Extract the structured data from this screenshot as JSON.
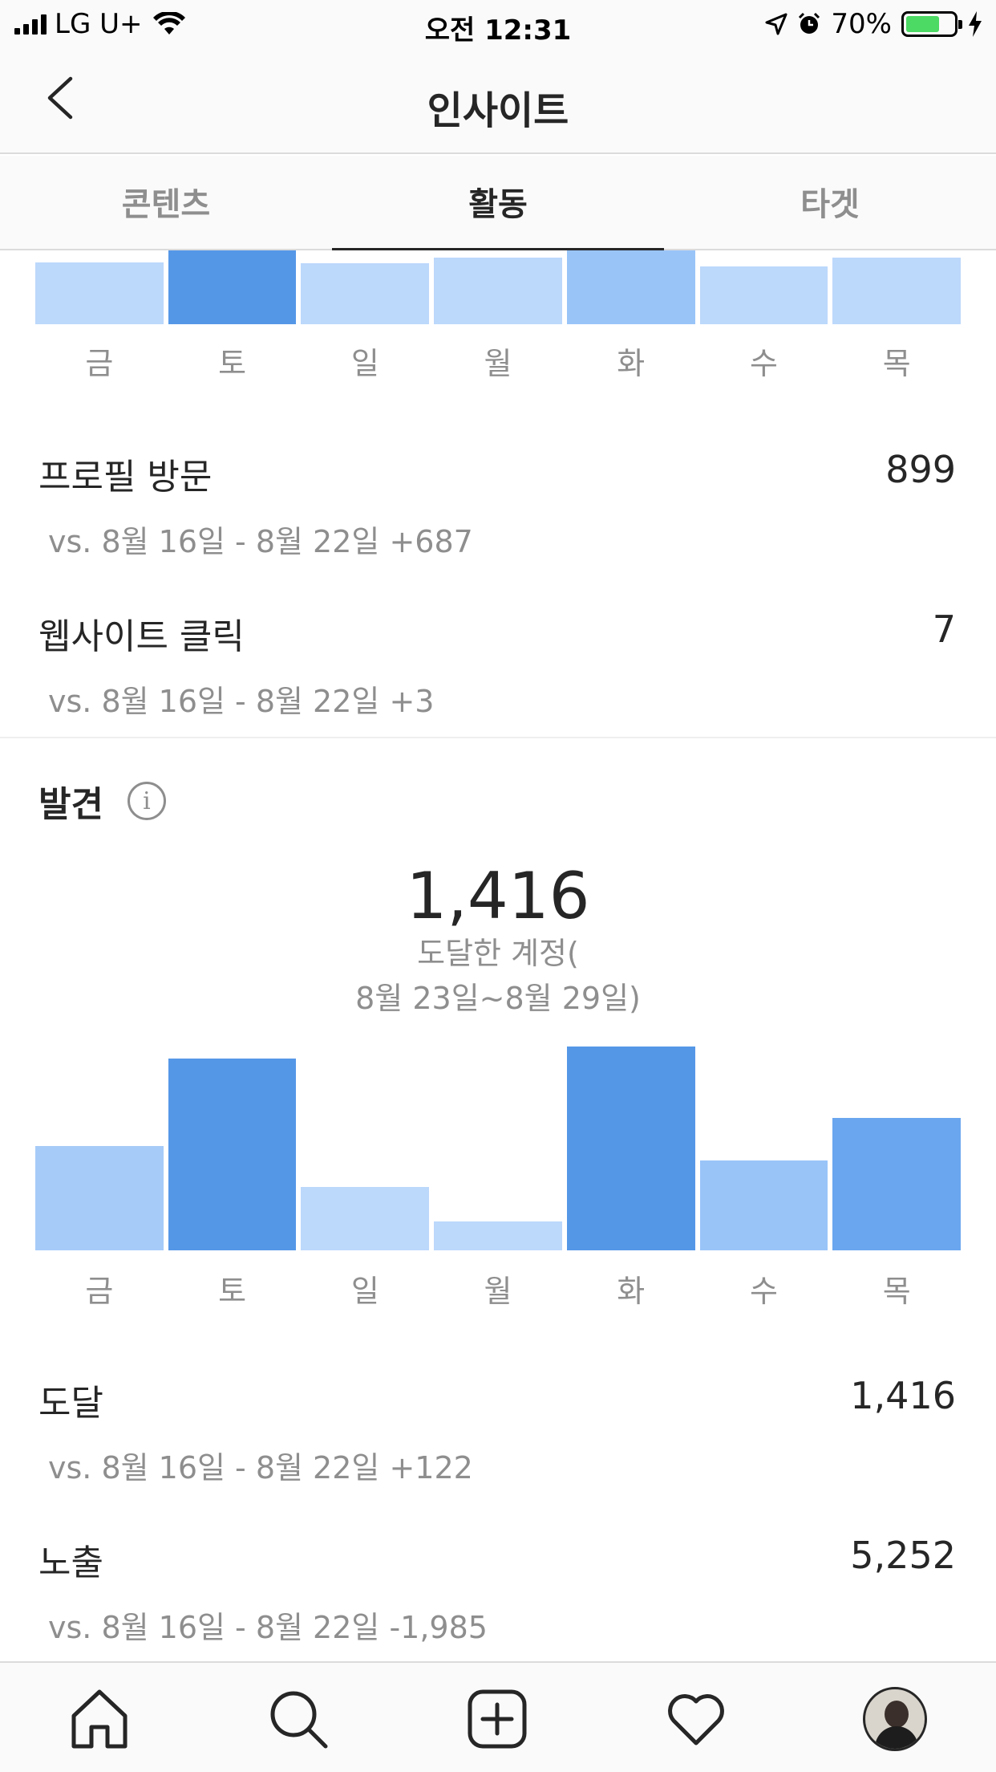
{
  "status_bar": {
    "carrier": "LG U+",
    "time": "오전 12:31",
    "battery_percent_label": "70%",
    "battery_level": 0.7
  },
  "nav": {
    "title": "인사이트"
  },
  "tabs": [
    {
      "label": "콘텐츠",
      "active": false
    },
    {
      "label": "활동",
      "active": true
    },
    {
      "label": "타겟",
      "active": false
    }
  ],
  "days": [
    "금",
    "토",
    "일",
    "월",
    "화",
    "수",
    "목"
  ],
  "chart_data": [
    {
      "type": "bar",
      "categories": [
        "금",
        "토",
        "일",
        "월",
        "화",
        "수",
        "목"
      ],
      "values": [
        0.84,
        1.0,
        0.83,
        0.9,
        1.0,
        0.78,
        0.9
      ],
      "note_values": "relative heights (top of chart cropped by scroll)"
    },
    {
      "type": "bar",
      "categories": [
        "금",
        "토",
        "일",
        "월",
        "화",
        "수",
        "목"
      ],
      "values": [
        0.51,
        0.94,
        0.31,
        0.14,
        1.0,
        0.44,
        0.65
      ]
    }
  ],
  "interactions": [
    {
      "label": "프로필 방문",
      "value": "899",
      "comparison": "vs. 8월 16일 - 8월 22일 +687"
    },
    {
      "label": "웹사이트 클릭",
      "value": "7",
      "comparison": "vs. 8월 16일 - 8월 22일 +3"
    }
  ],
  "discovery": {
    "title": "발견",
    "info_glyph": "i",
    "total": "1,416",
    "caption_line1": "도달한 계정(",
    "caption_line2": "8월 23일~8월 29일)",
    "metrics": [
      {
        "label": "도달",
        "value": "1,416",
        "comparison": "vs. 8월 16일 - 8월 22일 +122"
      },
      {
        "label": "노출",
        "value": "5,252",
        "comparison": "vs. 8월 16일 - 8월 22일 -1,985"
      }
    ]
  },
  "colors": {
    "bar_light": "#bcd8fb",
    "bar_mid": "#99c4f8",
    "bar_dark": "#5597e7",
    "text_primary": "#262626",
    "text_secondary": "#8e8e8e"
  },
  "tab_bar": {
    "icons": [
      "home-icon",
      "search-icon",
      "new-post-icon",
      "activity-heart-icon",
      "profile-avatar"
    ]
  }
}
